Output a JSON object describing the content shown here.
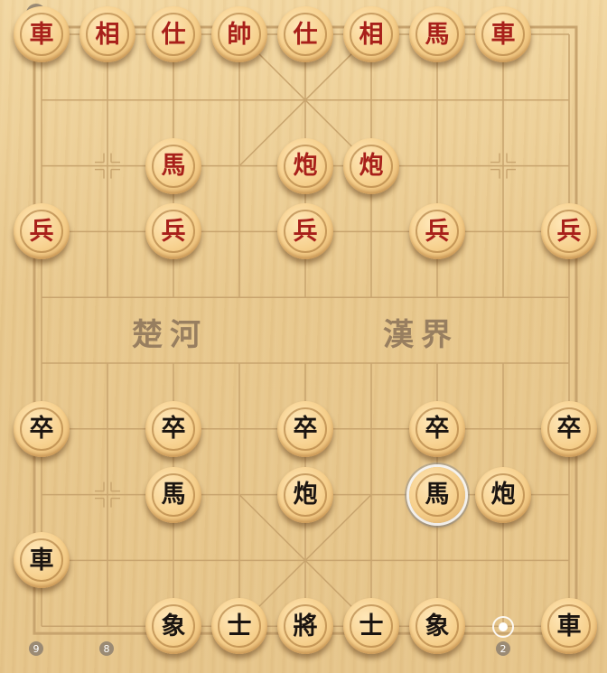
{
  "board": {
    "river_left": "楚河",
    "river_right": "漢界"
  },
  "coords": {
    "file_9": "9",
    "file_8": "8",
    "file_2": "2"
  },
  "pieces": [
    {
      "side": "red",
      "label": "車",
      "file": 0,
      "rank": 0
    },
    {
      "side": "red",
      "label": "相",
      "file": 1,
      "rank": 0
    },
    {
      "side": "red",
      "label": "仕",
      "file": 2,
      "rank": 0
    },
    {
      "side": "red",
      "label": "帥",
      "file": 3,
      "rank": 0
    },
    {
      "side": "red",
      "label": "仕",
      "file": 4,
      "rank": 0
    },
    {
      "side": "red",
      "label": "相",
      "file": 5,
      "rank": 0
    },
    {
      "side": "red",
      "label": "馬",
      "file": 6,
      "rank": 0
    },
    {
      "side": "red",
      "label": "車",
      "file": 7,
      "rank": 0
    },
    {
      "side": "red",
      "label": "馬",
      "file": 2,
      "rank": 2
    },
    {
      "side": "red",
      "label": "炮",
      "file": 4,
      "rank": 2
    },
    {
      "side": "red",
      "label": "炮",
      "file": 5,
      "rank": 2
    },
    {
      "side": "red",
      "label": "兵",
      "file": 0,
      "rank": 3
    },
    {
      "side": "red",
      "label": "兵",
      "file": 2,
      "rank": 3
    },
    {
      "side": "red",
      "label": "兵",
      "file": 4,
      "rank": 3
    },
    {
      "side": "red",
      "label": "兵",
      "file": 6,
      "rank": 3
    },
    {
      "side": "red",
      "label": "兵",
      "file": 8,
      "rank": 3
    },
    {
      "side": "black",
      "label": "卒",
      "file": 0,
      "rank": 6
    },
    {
      "side": "black",
      "label": "卒",
      "file": 2,
      "rank": 6
    },
    {
      "side": "black",
      "label": "卒",
      "file": 4,
      "rank": 6
    },
    {
      "side": "black",
      "label": "卒",
      "file": 6,
      "rank": 6
    },
    {
      "side": "black",
      "label": "卒",
      "file": 8,
      "rank": 6
    },
    {
      "side": "black",
      "label": "馬",
      "file": 2,
      "rank": 7
    },
    {
      "side": "black",
      "label": "炮",
      "file": 4,
      "rank": 7
    },
    {
      "side": "black",
      "label": "馬",
      "file": 6,
      "rank": 7,
      "selected": true
    },
    {
      "side": "black",
      "label": "炮",
      "file": 7,
      "rank": 7
    },
    {
      "side": "black",
      "label": "車",
      "file": 0,
      "rank": 8
    },
    {
      "side": "black",
      "label": "象",
      "file": 2,
      "rank": 9
    },
    {
      "side": "black",
      "label": "士",
      "file": 3,
      "rank": 9
    },
    {
      "side": "black",
      "label": "將",
      "file": 4,
      "rank": 9
    },
    {
      "side": "black",
      "label": "士",
      "file": 5,
      "rank": 9
    },
    {
      "side": "black",
      "label": "象",
      "file": 6,
      "rank": 9
    },
    {
      "side": "black",
      "label": "車",
      "file": 8,
      "rank": 9
    }
  ],
  "colors": {
    "red_text": "#a8201a",
    "black_text": "#1a1410",
    "line": "#c8a46e"
  }
}
